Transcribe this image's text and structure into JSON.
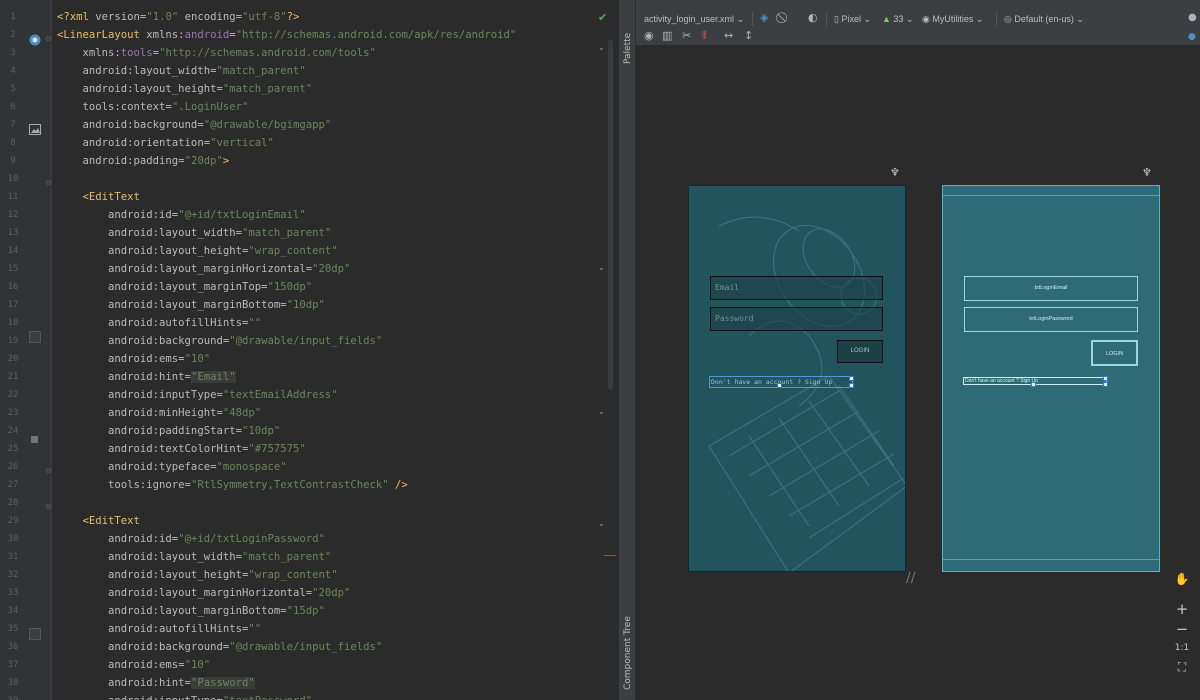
{
  "editor": {
    "lines": [
      {
        "n": "1",
        "parts": [
          [
            "t-tag",
            "<?xml "
          ],
          [
            "t-attr",
            "version="
          ],
          [
            "t-val",
            "\"1.0\" "
          ],
          [
            "t-attr",
            "encoding="
          ],
          [
            "t-val",
            "\"utf-8\""
          ],
          [
            "t-tag",
            "?>"
          ]
        ]
      },
      {
        "n": "2",
        "parts": [
          [
            "t-tag",
            "<LinearLayout "
          ],
          [
            "t-attr",
            "xmlns:"
          ],
          [
            "t-ns",
            "android"
          ],
          [
            "t-attr",
            "="
          ],
          [
            "t-val",
            "\"http://schemas.android.com/apk/res/android\""
          ]
        ]
      },
      {
        "n": "3",
        "parts": [
          [
            "t-attr",
            "    xmlns:"
          ],
          [
            "t-ns",
            "tools"
          ],
          [
            "t-attr",
            "="
          ],
          [
            "t-val",
            "\"http://schemas.android.com/tools\""
          ]
        ]
      },
      {
        "n": "4",
        "parts": [
          [
            "t-attr",
            "    android:layout_width="
          ],
          [
            "t-val",
            "\"match_parent\""
          ]
        ]
      },
      {
        "n": "5",
        "parts": [
          [
            "t-attr",
            "    android:layout_height="
          ],
          [
            "t-val",
            "\"match_parent\""
          ]
        ]
      },
      {
        "n": "6",
        "parts": [
          [
            "t-attr",
            "    tools:context="
          ],
          [
            "t-val",
            "\".LoginUser\""
          ]
        ]
      },
      {
        "n": "7",
        "parts": [
          [
            "t-attr",
            "    android:background="
          ],
          [
            "t-val",
            "\"@drawable/bgimgapp\""
          ]
        ]
      },
      {
        "n": "8",
        "parts": [
          [
            "t-attr",
            "    android:orientation="
          ],
          [
            "t-val",
            "\"vertical\""
          ]
        ]
      },
      {
        "n": "9",
        "parts": [
          [
            "t-attr",
            "    android:padding="
          ],
          [
            "t-val",
            "\"20dp\""
          ],
          [
            "t-tag",
            ">"
          ]
        ]
      },
      {
        "n": "10",
        "parts": []
      },
      {
        "n": "11",
        "parts": [
          [
            "t-tag",
            "    <EditText"
          ]
        ]
      },
      {
        "n": "12",
        "parts": [
          [
            "t-attr",
            "        android:id="
          ],
          [
            "t-val",
            "\"@+id/txtLoginEmail\""
          ]
        ]
      },
      {
        "n": "13",
        "parts": [
          [
            "t-attr",
            "        android:layout_width="
          ],
          [
            "t-val",
            "\"match_parent\""
          ]
        ]
      },
      {
        "n": "14",
        "parts": [
          [
            "t-attr",
            "        android:layout_height="
          ],
          [
            "t-val",
            "\"wrap_content\""
          ]
        ]
      },
      {
        "n": "15",
        "parts": [
          [
            "t-attr",
            "        android:layout_marginHorizontal="
          ],
          [
            "t-val",
            "\"20dp\""
          ]
        ]
      },
      {
        "n": "16",
        "parts": [
          [
            "t-attr",
            "        android:layout_marginTop="
          ],
          [
            "t-val",
            "\"150dp\""
          ]
        ]
      },
      {
        "n": "17",
        "parts": [
          [
            "t-attr",
            "        android:layout_marginBottom="
          ],
          [
            "t-val",
            "\"10dp\""
          ]
        ]
      },
      {
        "n": "18",
        "parts": [
          [
            "t-attr",
            "        android:autofillHints="
          ],
          [
            "t-val",
            "\"\""
          ]
        ]
      },
      {
        "n": "19",
        "parts": [
          [
            "t-attr",
            "        android:background="
          ],
          [
            "t-val",
            "\"@drawable/input_fields\""
          ]
        ]
      },
      {
        "n": "20",
        "parts": [
          [
            "t-attr",
            "        android:ems="
          ],
          [
            "t-val",
            "\"10\""
          ]
        ]
      },
      {
        "n": "21",
        "parts": [
          [
            "t-attr",
            "        android:hint="
          ],
          [
            "t-val t-hl",
            "\"Email\""
          ]
        ]
      },
      {
        "n": "22",
        "parts": [
          [
            "t-attr",
            "        android:inputType="
          ],
          [
            "t-val",
            "\"textEmailAddress\""
          ]
        ]
      },
      {
        "n": "23",
        "parts": [
          [
            "t-attr",
            "        android:minHeight="
          ],
          [
            "t-val",
            "\"48dp\""
          ]
        ]
      },
      {
        "n": "24",
        "parts": [
          [
            "t-attr",
            "        android:paddingStart="
          ],
          [
            "t-val",
            "\"10dp\""
          ]
        ]
      },
      {
        "n": "25",
        "parts": [
          [
            "t-attr",
            "        android:textColorHint="
          ],
          [
            "t-val",
            "\"#757575\""
          ]
        ]
      },
      {
        "n": "26",
        "parts": [
          [
            "t-attr",
            "        android:typeface="
          ],
          [
            "t-val",
            "\"monospace\""
          ]
        ]
      },
      {
        "n": "27",
        "parts": [
          [
            "t-attr",
            "        tools:ignore="
          ],
          [
            "t-val",
            "\"RtlSymmetry,TextContrastCheck\" "
          ],
          [
            "t-tag",
            "/>"
          ]
        ]
      },
      {
        "n": "28",
        "parts": []
      },
      {
        "n": "29",
        "parts": [
          [
            "t-tag",
            "    <EditText"
          ]
        ]
      },
      {
        "n": "30",
        "parts": [
          [
            "t-attr",
            "        android:id="
          ],
          [
            "t-val",
            "\"@+id/txtLoginPassword\""
          ]
        ]
      },
      {
        "n": "31",
        "parts": [
          [
            "t-attr",
            "        android:layout_width="
          ],
          [
            "t-val",
            "\"match_parent\""
          ]
        ]
      },
      {
        "n": "32",
        "parts": [
          [
            "t-attr",
            "        android:layout_height="
          ],
          [
            "t-val",
            "\"wrap_content\""
          ]
        ]
      },
      {
        "n": "33",
        "parts": [
          [
            "t-attr",
            "        android:layout_marginHorizontal="
          ],
          [
            "t-val",
            "\"20dp\""
          ]
        ]
      },
      {
        "n": "34",
        "parts": [
          [
            "t-attr",
            "        android:layout_marginBottom="
          ],
          [
            "t-val",
            "\"15dp\""
          ]
        ]
      },
      {
        "n": "35",
        "parts": [
          [
            "t-attr",
            "        android:autofillHints="
          ],
          [
            "t-val",
            "\"\""
          ]
        ]
      },
      {
        "n": "36",
        "parts": [
          [
            "t-attr",
            "        android:background="
          ],
          [
            "t-val",
            "\"@drawable/input_fields\""
          ]
        ]
      },
      {
        "n": "37",
        "parts": [
          [
            "t-attr",
            "        android:ems="
          ],
          [
            "t-val",
            "\"10\""
          ]
        ]
      },
      {
        "n": "38",
        "parts": [
          [
            "t-attr",
            "        android:hint="
          ],
          [
            "t-val t-hl",
            "\"Password\""
          ]
        ]
      },
      {
        "n": "39",
        "parts": [
          [
            "t-attr",
            "        android:inputType="
          ],
          [
            "t-val",
            "\"textPassword\""
          ]
        ]
      }
    ]
  },
  "toolstrip": {
    "palette_label": "Palette",
    "component_tree_label": "Component Tree"
  },
  "toolbar": {
    "file_name": "activity_login_user.xml",
    "device": "Pixel",
    "api_level": "33",
    "theme": "MyUtilities",
    "locale": "Default (en-us)"
  },
  "preview": {
    "email_hint": "Email",
    "password_hint": "Password",
    "login_label": "LOGIN",
    "signup_link": "Don't have an account ? Sign Up",
    "bp_email": "txtLoginEmail",
    "bp_password": "txtLoginPassword",
    "bp_login": "LOGIN",
    "bp_link": "Don't have an account ? Sign Up"
  },
  "zoom": {
    "zoom_in": "+",
    "zoom_out": "−",
    "actual_size": "1:1"
  },
  "colors": {
    "editor_bg": "#2b2b2b",
    "tag": "#e8bf6a",
    "value": "#6a8759",
    "preview_teal": "#21545d",
    "blueprint_teal": "#2f6b76"
  }
}
